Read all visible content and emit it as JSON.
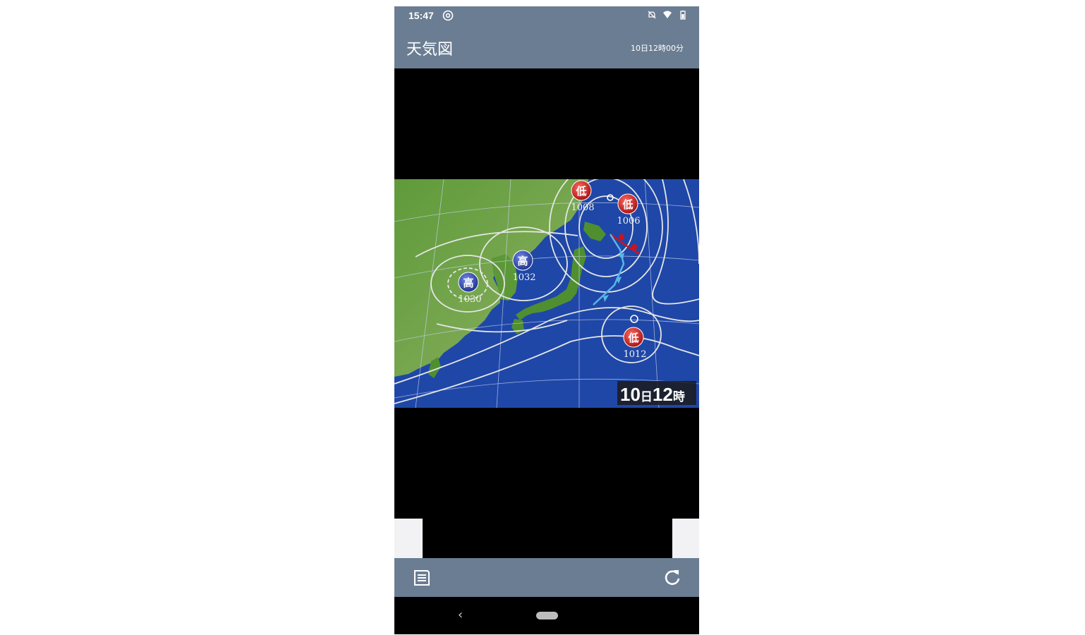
{
  "status_bar": {
    "time": "15:47",
    "left_icon": "at-sign-icon",
    "right_icons": [
      "notifications-off-icon",
      "wifi-icon",
      "battery-icon"
    ]
  },
  "app_bar": {
    "title": "天気図",
    "timestamp": "10日12時00分"
  },
  "map": {
    "stamp_day": "10",
    "stamp_day_unit": "日",
    "stamp_hour": "12",
    "stamp_hour_unit": "時",
    "pressure_systems": [
      {
        "kind": "低",
        "value": "1008"
      },
      {
        "kind": "低",
        "value": "1006"
      },
      {
        "kind": "高",
        "value": "1032"
      },
      {
        "kind": "高",
        "value": "1030"
      },
      {
        "kind": "低",
        "value": "1012"
      }
    ],
    "colors": {
      "sea": "#1f47a8",
      "land": "#4f8f30",
      "high_marker": "#2a3f9e",
      "low_marker": "#c2161b",
      "isobar": "#e6e6e6"
    }
  },
  "bottom_bar": {
    "left_button_icon": "list-icon",
    "right_button_icon": "refresh-icon"
  },
  "nav_bar": {
    "back_icon": "back-chevron-icon",
    "home_icon": "home-pill-icon"
  },
  "theme": {
    "bar_color": "#6b7d92"
  }
}
